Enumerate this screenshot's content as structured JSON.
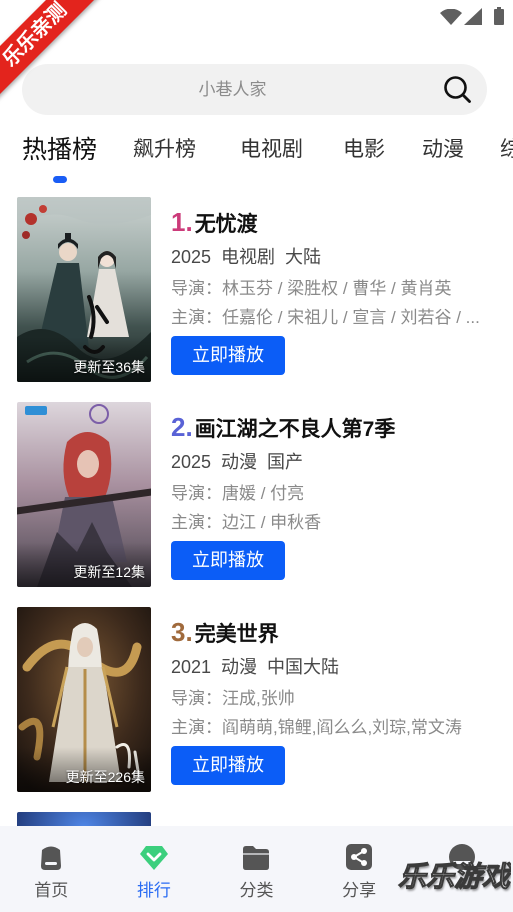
{
  "colors": {
    "accent": "#0b5df7",
    "nav_active": "#2a6cf3",
    "tab_indicator": "#1a5df5",
    "ribbon": "#e3241d",
    "ranking_gem": "#3ccf7d"
  },
  "status_bar": {
    "icons": [
      "wifi-icon",
      "signal-icon",
      "battery-icon"
    ]
  },
  "corner_ribbon": {
    "text": "乐乐亲测"
  },
  "search": {
    "placeholder": "小巷人家",
    "icon": "search-icon"
  },
  "tabs": [
    {
      "label": "热播榜",
      "active": true
    },
    {
      "label": "飙升榜",
      "active": false
    },
    {
      "label": "电视剧",
      "active": false
    },
    {
      "label": "电影",
      "active": false
    },
    {
      "label": "动漫",
      "active": false
    },
    {
      "label": "综",
      "active": false
    }
  ],
  "ranking": [
    {
      "rank": "1.",
      "rank_color": "#cc3b7a",
      "title": "无忧渡",
      "year": "2025",
      "genre": "电视剧",
      "region": "大陆",
      "director": "导演：林玉芬 / 梁胜权 / 曹华 / 黄肖英",
      "cast": "主演：任嘉伦 / 宋祖儿 / 宣言 / 刘若谷 / ...",
      "update": "更新至36集",
      "play_label": "立即播放"
    },
    {
      "rank": "2.",
      "rank_color": "#5962d6",
      "title": "画江湖之不良人第7季",
      "year": "2025",
      "genre": "动漫",
      "region": "国产",
      "director": "导演：唐媛 / 付亮",
      "cast": "主演：边江 / 申秋香",
      "update": "更新至12集",
      "play_label": "立即播放"
    },
    {
      "rank": "3.",
      "rank_color": "#a06a3c",
      "title": "完美世界",
      "year": "2021",
      "genre": "动漫",
      "region": "中国大陆",
      "director": "导演：汪成,张帅",
      "cast": "主演：阎萌萌,锦鲤,阎么么,刘琮,常文涛",
      "update": "更新至226集",
      "play_label": "立即播放"
    }
  ],
  "bottom_nav": [
    {
      "label": "首页",
      "icon": "home-icon",
      "active": false
    },
    {
      "label": "排行",
      "icon": "ranking-gem-icon",
      "active": true
    },
    {
      "label": "分类",
      "icon": "folder-icon",
      "active": false
    },
    {
      "label": "分享",
      "icon": "share-icon",
      "active": false
    },
    {
      "icon": "user-icon",
      "active": false
    }
  ],
  "watermark": {
    "text": "乐乐游戏"
  }
}
